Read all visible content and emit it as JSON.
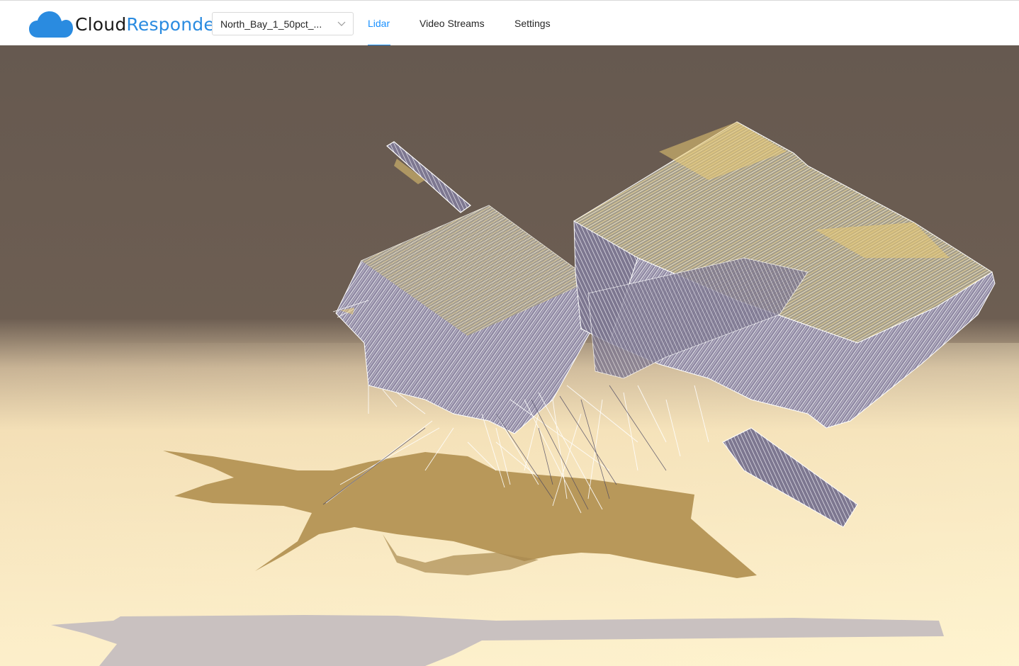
{
  "app": {
    "logo_part1": "Cloud",
    "logo_part2": "Responder",
    "logo_icon": "cloud-icon",
    "brand_color": "#2a8be0"
  },
  "dataset_select": {
    "value": "North_Bay_1_50pct_...",
    "icon": "chevron-down-icon"
  },
  "nav": {
    "tabs": [
      {
        "label": "Lidar",
        "active": true
      },
      {
        "label": "Video Streams",
        "active": false
      },
      {
        "label": "Settings",
        "active": false
      }
    ],
    "active_color": "#1890ff"
  },
  "viewer": {
    "sky_color": "#665950",
    "ground_color": "#fdf0cc",
    "shadow_color": "#b8985a",
    "model_color": "#a9a2b8"
  }
}
